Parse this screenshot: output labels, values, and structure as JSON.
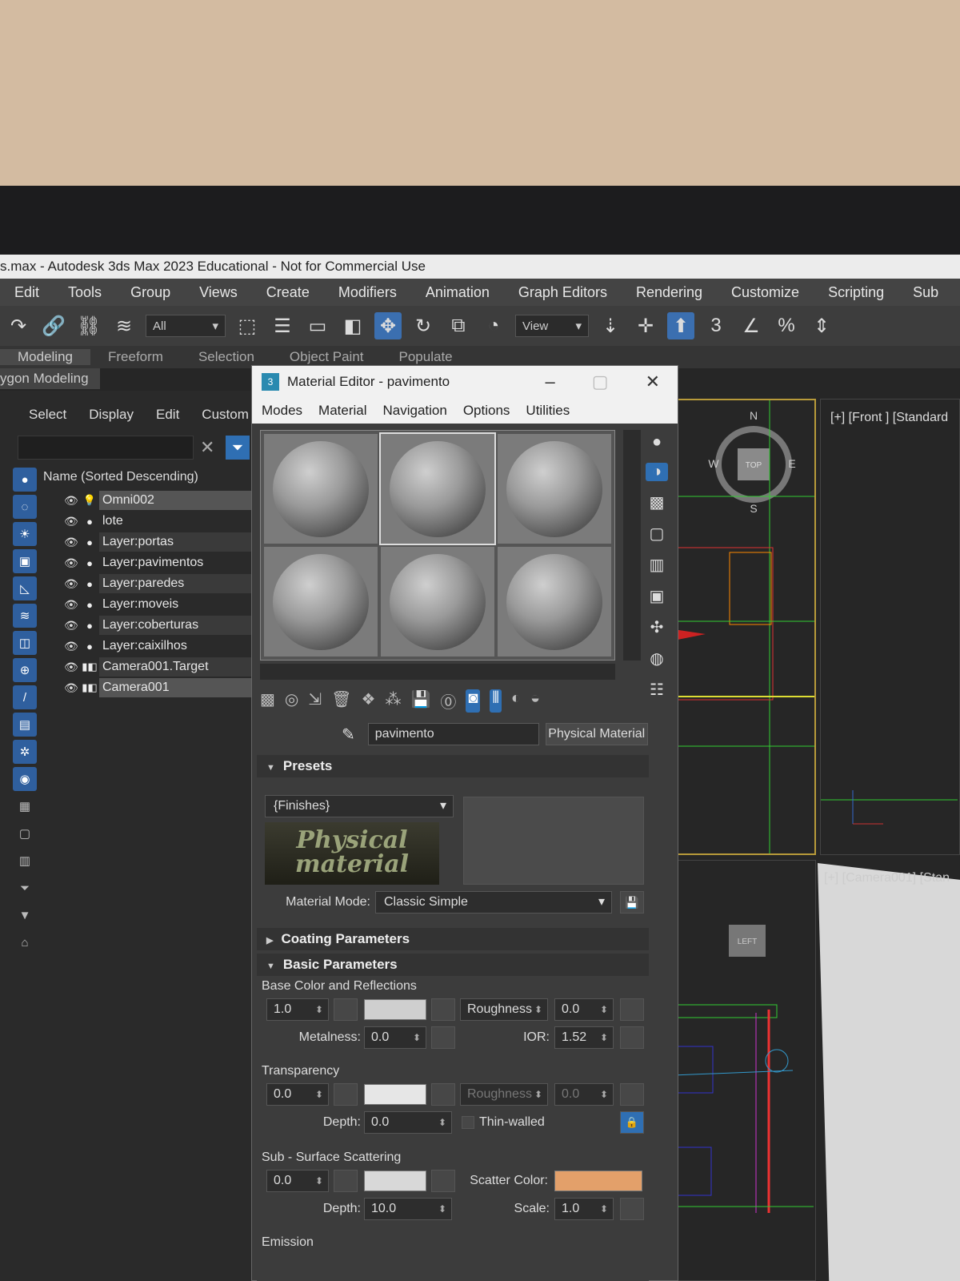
{
  "window": {
    "title": "s.max - Autodesk 3ds Max 2023 Educational - Not for Commercial Use"
  },
  "menubar": [
    "Edit",
    "Tools",
    "Group",
    "Views",
    "Create",
    "Modifiers",
    "Animation",
    "Graph Editors",
    "Rendering",
    "Customize",
    "Scripting",
    "Sub"
  ],
  "toolbar": {
    "selection_filter": "All",
    "ref_coord": "View"
  },
  "ribbon": {
    "tabs": [
      "Modeling",
      "Freeform",
      "Selection",
      "Object Paint",
      "Populate"
    ],
    "subtab": "ygon Modeling"
  },
  "explorer": {
    "menu": [
      "Select",
      "Display",
      "Edit",
      "Custom"
    ],
    "column_header": "Name (Sorted Descending)",
    "rows": [
      {
        "name": "Omni002",
        "icon": "light-icon"
      },
      {
        "name": "lote",
        "icon": "sphere-icon"
      },
      {
        "name": "Layer:portas",
        "icon": "sphere-icon"
      },
      {
        "name": "Layer:pavimentos",
        "icon": "sphere-icon"
      },
      {
        "name": "Layer:paredes",
        "icon": "sphere-icon"
      },
      {
        "name": "Layer:moveis",
        "icon": "sphere-icon"
      },
      {
        "name": "Layer:coberturas",
        "icon": "sphere-icon"
      },
      {
        "name": "Layer:caixilhos",
        "icon": "sphere-icon"
      },
      {
        "name": "Camera001.Target",
        "icon": "camera-icon"
      },
      {
        "name": "Camera001",
        "icon": "camera-icon"
      }
    ]
  },
  "viewports": {
    "front_label": "[+] [Front ] [Standard",
    "camera_label": "[+] [Camera001] [Stan",
    "viewcube_top": "TOP",
    "viewcube_left": "LEFT",
    "compass": {
      "n": "N",
      "s": "S",
      "e": "E",
      "w": "W"
    }
  },
  "material_editor": {
    "title": "Material Editor - pavimento",
    "menu": [
      "Modes",
      "Material",
      "Navigation",
      "Options",
      "Utilities"
    ],
    "material_name": "pavimento",
    "material_type": "Physical Material",
    "presets": {
      "heading": "Presets",
      "preset_value": "{Finishes}",
      "logo_line1": "Physical",
      "logo_line2": "material",
      "mode_label": "Material Mode:",
      "mode_value": "Classic Simple"
    },
    "coating": {
      "heading": "Coating Parameters"
    },
    "basic": {
      "heading": "Basic Parameters",
      "base_group": "Base Color and Reflections",
      "base_weight": "1.0",
      "roughness_label": "Roughness",
      "roughness_value": "0.0",
      "metalness_label": "Metalness:",
      "metalness_value": "0.0",
      "ior_label": "IOR:",
      "ior_value": "1.52",
      "transparency_group": "Transparency",
      "transparency_weight": "0.0",
      "transparency_roughness_label": "Roughness",
      "transparency_roughness_value": "0.0",
      "transparency_depth_label": "Depth:",
      "transparency_depth_value": "0.0",
      "thin_walled_label": "Thin-walled",
      "sss_group": "Sub - Surface Scattering",
      "sss_weight": "0.0",
      "scatter_color_label": "Scatter Color:",
      "sss_depth_label": "Depth:",
      "sss_depth_value": "10.0",
      "sss_scale_label": "Scale:",
      "sss_scale_value": "1.0",
      "emission_group": "Emission"
    },
    "colors": {
      "base": "#cfcfcf",
      "transparency": "#e6e6e6",
      "sss": "#d8d8d8",
      "scatter": "#e3a06a"
    }
  }
}
